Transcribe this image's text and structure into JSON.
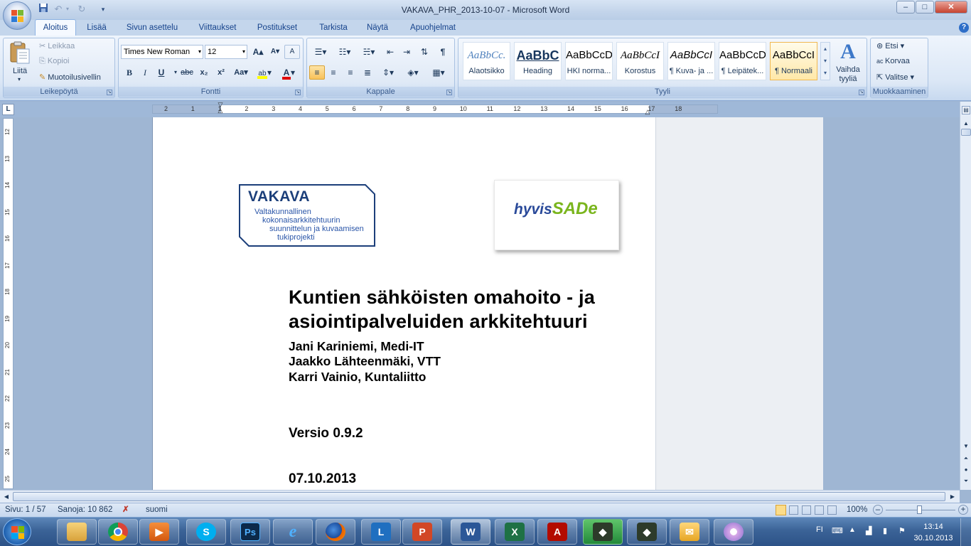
{
  "window": {
    "title": "VAKAVA_PHR_2013-10-07 - Microsoft Word",
    "minimize": "–",
    "maximize": "□",
    "close": "✕"
  },
  "qat": {
    "save_icon": "save-icon",
    "undo_icon": "undo-icon",
    "redo_icon": "redo-icon",
    "customize": "▾"
  },
  "tabs": [
    "Aloitus",
    "Lisää",
    "Sivun asettelu",
    "Viittaukset",
    "Postitukset",
    "Tarkista",
    "Näytä",
    "Apuohjelmat"
  ],
  "active_tab": "Aloitus",
  "ribbon": {
    "clipboard": {
      "label": "Leikepöytä",
      "paste": "Liitä",
      "cut": "Leikkaa",
      "copy": "Kopioi",
      "format_painter": "Muotoilusivellin"
    },
    "font": {
      "label": "Fontti",
      "font_name": "Times New Roman",
      "font_size": "12",
      "bold": "B",
      "italic": "I",
      "underline": "U",
      "strike": "abc",
      "subscript": "x₂",
      "superscript": "x²",
      "change_case": "Aa",
      "grow": "A",
      "shrink": "A",
      "clear": "A"
    },
    "paragraph": {
      "label": "Kappale"
    },
    "styles": {
      "label": "Tyyli",
      "items": [
        {
          "preview": "AaBbCc.",
          "name": "Alaotsikko"
        },
        {
          "preview": "AaBbC",
          "name": "Heading"
        },
        {
          "preview": "AaBbCcD",
          "name": "HKI norma..."
        },
        {
          "preview": "AaBbCcI",
          "name": "Korostus"
        },
        {
          "preview": "AaBbCcI",
          "name": "¶ Kuva- ja ..."
        },
        {
          "preview": "AaBbCcD",
          "name": "¶ Leipätek..."
        },
        {
          "preview": "AaBbCcI",
          "name": "¶ Normaali"
        }
      ],
      "change_styles": "Vaihda tyyliä"
    },
    "editing": {
      "label": "Muokkaaminen",
      "find": "Etsi",
      "replace": "Korvaa",
      "select": "Valitse"
    }
  },
  "ruler": {
    "h_ticks": [
      "2",
      "1",
      "1",
      "2",
      "3",
      "4",
      "5",
      "6",
      "7",
      "8",
      "9",
      "10",
      "11",
      "12",
      "13",
      "14",
      "15",
      "16",
      "17",
      "18"
    ],
    "v_ticks": [
      "12",
      "13",
      "14",
      "15",
      "16",
      "17",
      "18",
      "19",
      "20",
      "21",
      "22",
      "23",
      "24",
      "25"
    ],
    "tab_selector": "L"
  },
  "document": {
    "logo_left": {
      "name": "VAKAVA",
      "lines": [
        "Valtakunnallinen",
        "kokonaisarkkitehtuurin",
        "suunnittelun ja kuvaamisen",
        "tukiprojekti"
      ]
    },
    "logo_right": {
      "part1": "hyvis",
      "part2": "SADe"
    },
    "title_line1": "Kuntien sähköisten omahoito - ja",
    "title_line2": "asiointipalveluiden arkkitehtuuri",
    "authors": [
      "Jani Kariniemi, Medi-IT",
      "Jaakko Lähteenmäki, VTT",
      "Karri Vainio, Kuntaliitto"
    ],
    "version": "Versio 0.9.2",
    "date": "07.10.2013"
  },
  "status": {
    "page": "Sivu: 1 / 57",
    "words": "Sanoja: 10 862",
    "language": "suomi",
    "zoom": "100%",
    "zoom_out": "–",
    "zoom_in": "+"
  },
  "taskbar": {
    "apps": [
      {
        "name": "start-button",
        "icon": "windows-logo"
      },
      {
        "name": "explorer",
        "label": ""
      },
      {
        "name": "chrome",
        "label": ""
      },
      {
        "name": "media",
        "label": ""
      },
      {
        "name": "skype",
        "label": "S"
      },
      {
        "name": "photoshop",
        "label": "Ps"
      },
      {
        "name": "ie",
        "label": "e"
      },
      {
        "name": "firefox",
        "label": ""
      },
      {
        "name": "lync",
        "label": "L"
      },
      {
        "name": "powerpoint",
        "label": "P"
      },
      {
        "name": "word",
        "label": "W"
      },
      {
        "name": "excel",
        "label": "X"
      },
      {
        "name": "acrobat",
        "label": "A"
      },
      {
        "name": "app-green",
        "label": ""
      },
      {
        "name": "app-dark",
        "label": ""
      },
      {
        "name": "outlook",
        "label": ""
      },
      {
        "name": "paint",
        "label": ""
      }
    ],
    "lang": "FI",
    "time": "13:14",
    "date": "30.10.2013"
  },
  "colors": {
    "vakava_blue": "#1c3f7a",
    "hyvis_blue": "#2a4a9a",
    "sade_green": "#7ab51d",
    "ribbon_text": "#1e395b"
  }
}
